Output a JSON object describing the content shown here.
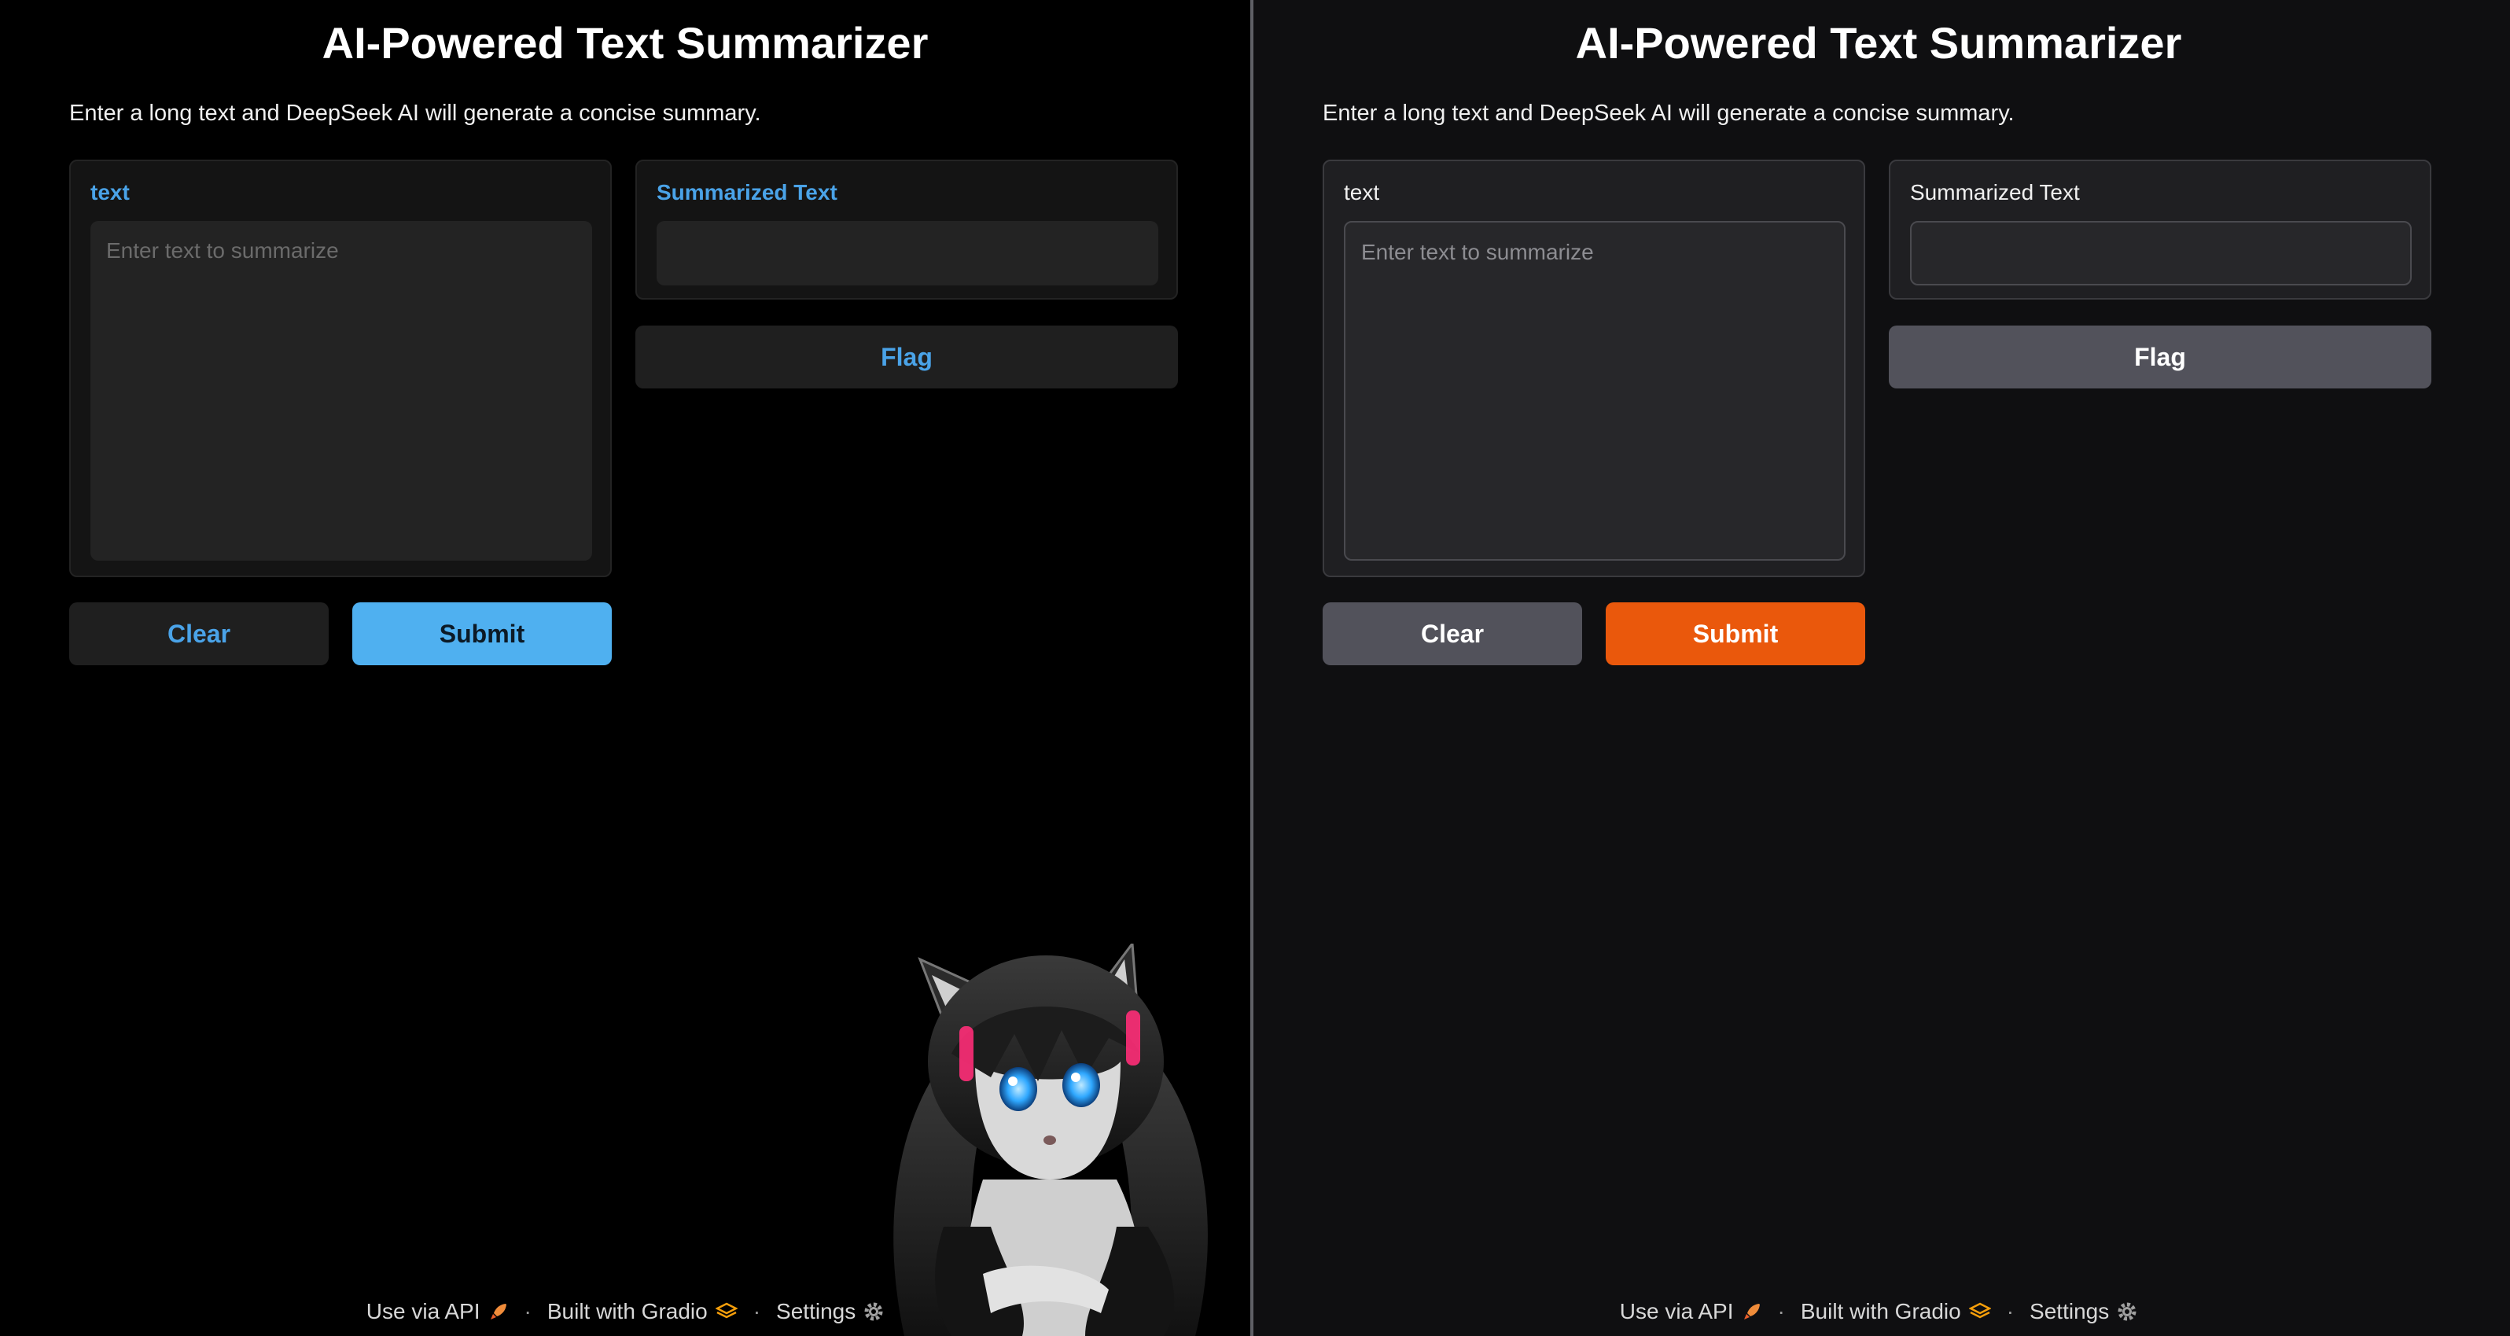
{
  "left_panel": {
    "title": "AI-Powered Text Summarizer",
    "description": "Enter a long text and DeepSeek AI will generate a concise summary.",
    "input_label": "text",
    "input_placeholder": "Enter text to summarize",
    "output_label": "Summarized Text",
    "flag_label": "Flag",
    "clear_label": "Clear",
    "submit_label": "Submit",
    "footer": {
      "api_label": "Use via API",
      "gradio_label": "Built with Gradio",
      "settings_label": "Settings"
    }
  },
  "right_panel": {
    "title": "AI-Powered Text Summarizer",
    "description": "Enter a long text and DeepSeek AI will generate a concise summary.",
    "input_label": "text",
    "input_placeholder": "Enter text to summarize",
    "output_label": "Summarized Text",
    "flag_label": "Flag",
    "clear_label": "Clear",
    "submit_label": "Submit",
    "footer": {
      "api_label": "Use via API",
      "gradio_label": "Built with Gradio",
      "settings_label": "Settings"
    }
  },
  "colors": {
    "left_accent": "#4aa3e8",
    "left_submit_bg": "#4fb0f0",
    "right_submit_bg": "#ea580c",
    "right_neutral_button": "#52525b"
  },
  "icons": [
    "rocket-icon",
    "gradio-logo-icon",
    "gear-icon"
  ]
}
